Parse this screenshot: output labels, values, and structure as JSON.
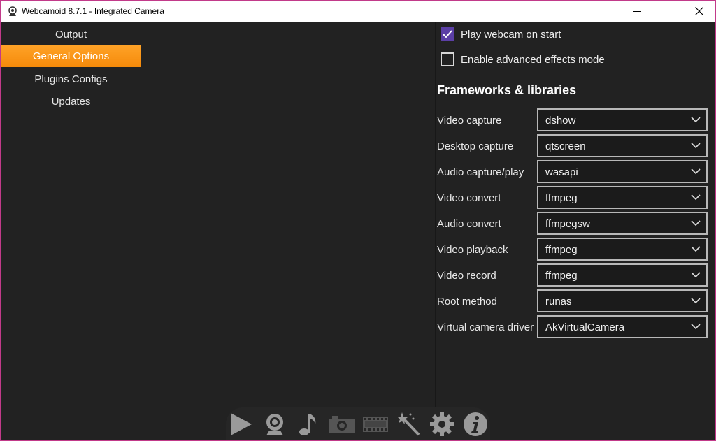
{
  "window": {
    "title": "Webcamoid 8.7.1 - Integrated Camera",
    "accent_color": "#f7941d",
    "checkbox_color": "#5b3fa6"
  },
  "sidebar": {
    "items": [
      {
        "label": "Output",
        "active": false
      },
      {
        "label": "General Options",
        "active": true
      },
      {
        "label": "Plugins Configs",
        "active": false
      },
      {
        "label": "Updates",
        "active": false
      }
    ]
  },
  "options": {
    "play_on_start": {
      "label": "Play webcam on start",
      "checked": true
    },
    "advanced_effects": {
      "label": "Enable advanced effects mode",
      "checked": false
    }
  },
  "frameworks": {
    "title": "Frameworks & libraries",
    "rows": [
      {
        "label": "Video capture",
        "value": "dshow"
      },
      {
        "label": "Desktop capture",
        "value": "qtscreen"
      },
      {
        "label": "Audio capture/play",
        "value": "wasapi"
      },
      {
        "label": "Video convert",
        "value": "ffmpeg"
      },
      {
        "label": "Audio convert",
        "value": "ffmpegsw"
      },
      {
        "label": "Video playback",
        "value": "ffmpeg"
      },
      {
        "label": "Video record",
        "value": "ffmpeg"
      },
      {
        "label": "Root method",
        "value": "runas"
      },
      {
        "label": "Virtual camera driver",
        "value": "AkVirtualCamera"
      }
    ]
  },
  "toolbar": {
    "icons": [
      "play-icon",
      "webcam-icon",
      "music-note-icon",
      "camera-icon",
      "film-strip-icon",
      "magic-wand-icon",
      "gear-icon",
      "info-icon"
    ]
  }
}
